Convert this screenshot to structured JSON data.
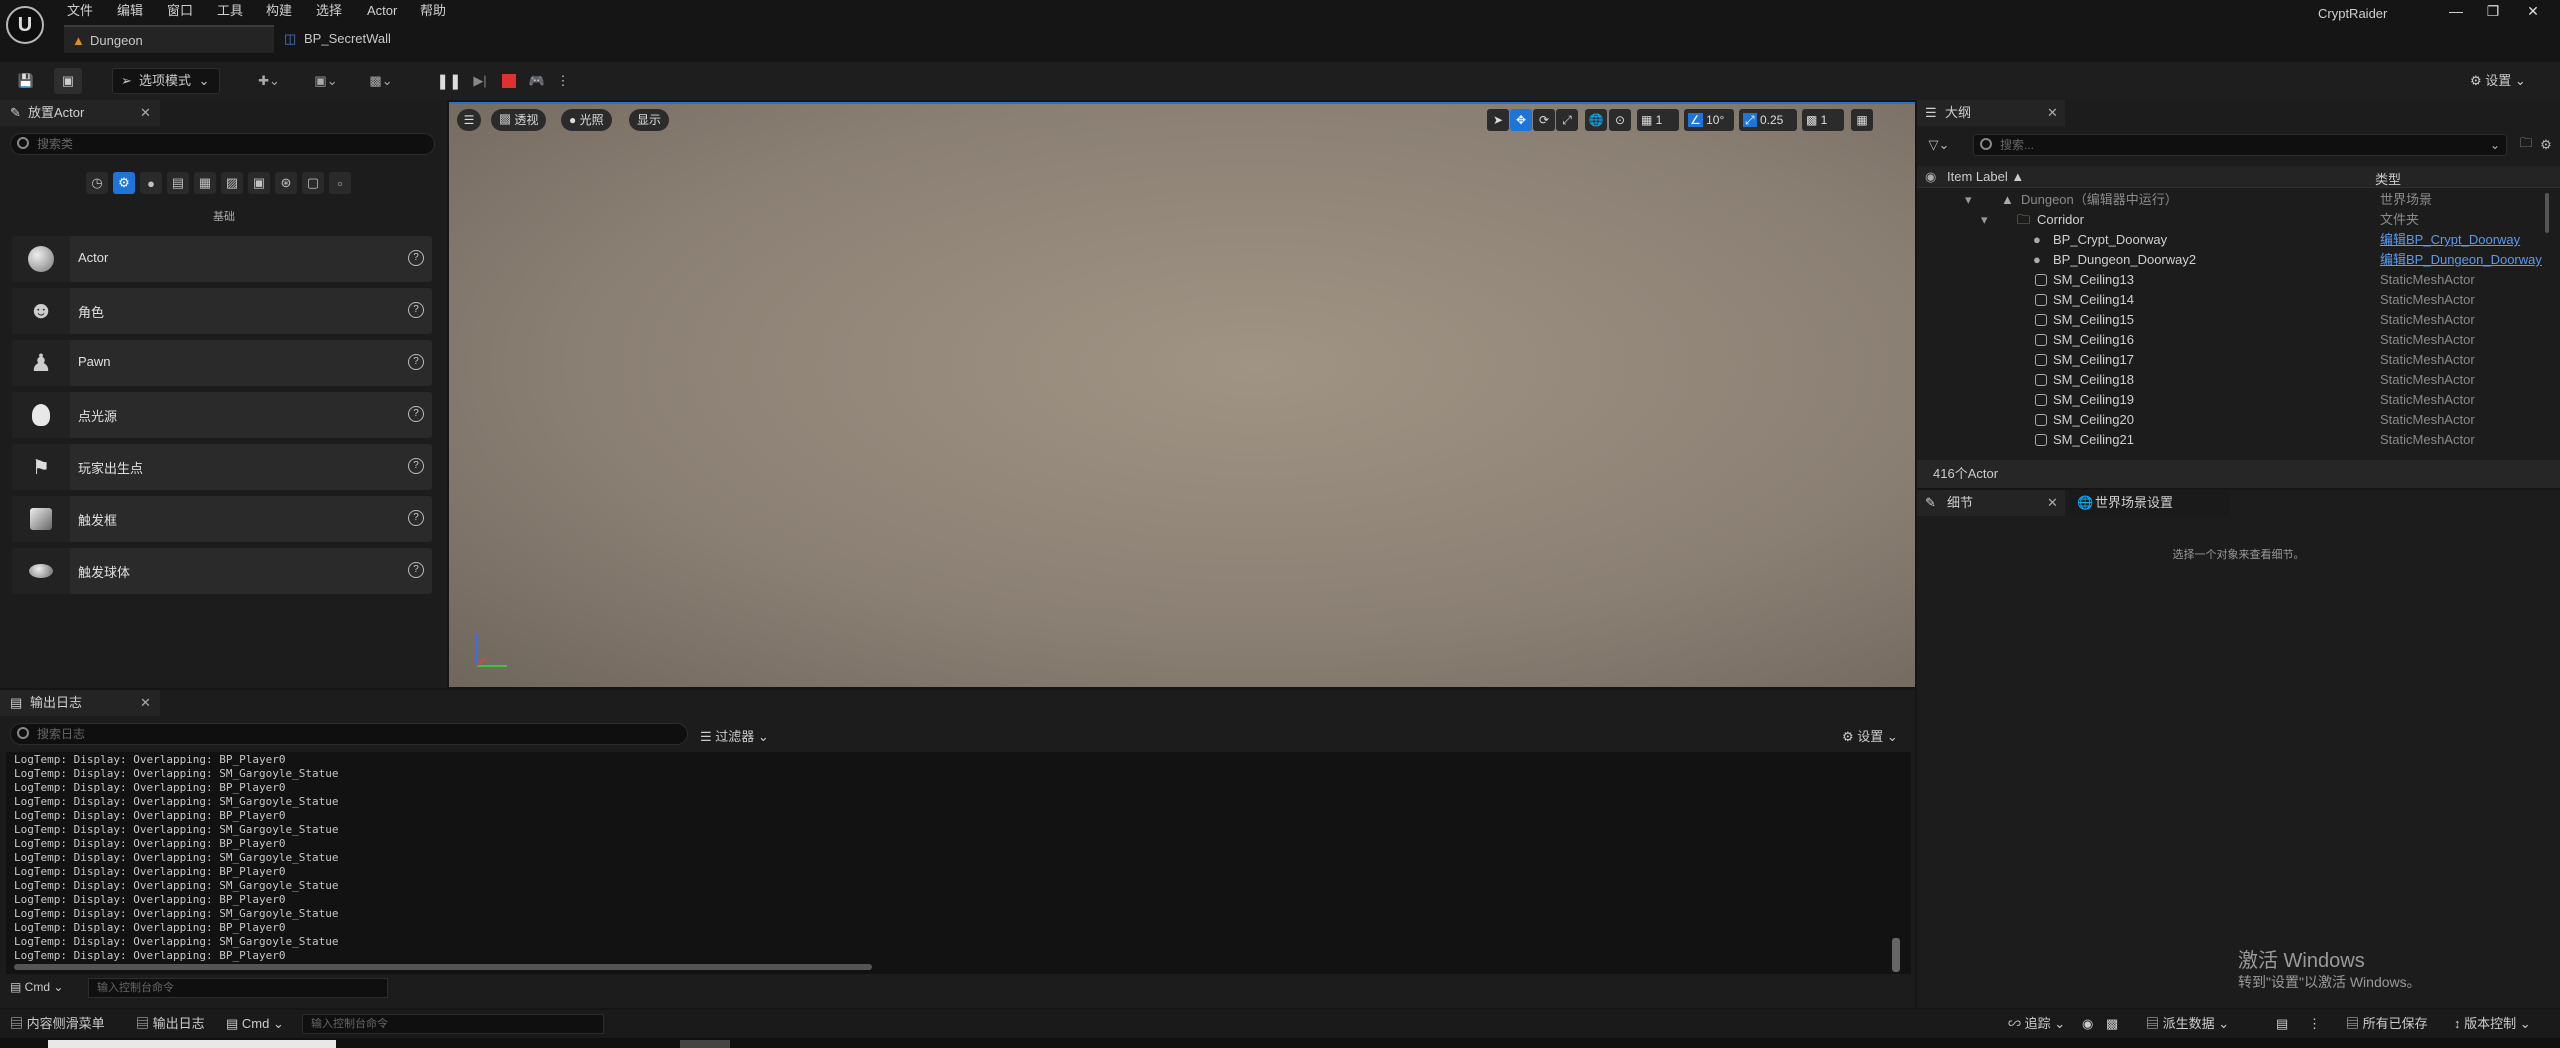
{
  "window": {
    "app_title": "CryptRaider",
    "menu": [
      "文件",
      "编辑",
      "窗口",
      "工具",
      "构建",
      "选择",
      "Actor",
      "帮助"
    ],
    "tabs": [
      {
        "label": "Dungeon"
      },
      {
        "label": "BP_SecretWall"
      }
    ]
  },
  "toolbar": {
    "mode_label": "选项模式",
    "settings_label": "设置"
  },
  "place_actors": {
    "title": "放置Actor",
    "search_placeholder": "搜索类",
    "category_label": "基础",
    "items": [
      {
        "label": "Actor",
        "icon": "sphere-icon"
      },
      {
        "label": "角色",
        "icon": "character-icon"
      },
      {
        "label": "Pawn",
        "icon": "pawn-icon"
      },
      {
        "label": "点光源",
        "icon": "lightbulb-icon"
      },
      {
        "label": "玩家出生点",
        "icon": "player-start-icon"
      },
      {
        "label": "触发框",
        "icon": "trigger-box-icon"
      },
      {
        "label": "触发球体",
        "icon": "trigger-sphere-icon"
      }
    ]
  },
  "viewport": {
    "perspective_label": "透视",
    "lighting_label": "光照",
    "show_label": "显示",
    "grid_value": "1",
    "angle_value": "10°",
    "scale_value": "0.25",
    "camera_speed": "1"
  },
  "outliner": {
    "title": "大纲",
    "search_placeholder": "搜索...",
    "col_label": "Item Label ▲",
    "col_type": "类型",
    "rows": [
      {
        "name": "Dungeon（编辑器中运行）",
        "type": "世界场景",
        "indent": 1,
        "kind": "world"
      },
      {
        "name": "Corridor",
        "type": "文件夹",
        "indent": 2,
        "kind": "folder"
      },
      {
        "name": "BP_Crypt_Doorway",
        "type": "编辑BP_Crypt_Doorway",
        "indent": 3,
        "kind": "bp"
      },
      {
        "name": "BP_Dungeon_Doorway2",
        "type": "编辑BP_Dungeon_Doorway",
        "indent": 3,
        "kind": "bp"
      },
      {
        "name": "SM_Ceiling13",
        "type": "StaticMeshActor",
        "indent": 3,
        "kind": "mesh"
      },
      {
        "name": "SM_Ceiling14",
        "type": "StaticMeshActor",
        "indent": 3,
        "kind": "mesh"
      },
      {
        "name": "SM_Ceiling15",
        "type": "StaticMeshActor",
        "indent": 3,
        "kind": "mesh"
      },
      {
        "name": "SM_Ceiling16",
        "type": "StaticMeshActor",
        "indent": 3,
        "kind": "mesh"
      },
      {
        "name": "SM_Ceiling17",
        "type": "StaticMeshActor",
        "indent": 3,
        "kind": "mesh"
      },
      {
        "name": "SM_Ceiling18",
        "type": "StaticMeshActor",
        "indent": 3,
        "kind": "mesh"
      },
      {
        "name": "SM_Ceiling19",
        "type": "StaticMeshActor",
        "indent": 3,
        "kind": "mesh"
      },
      {
        "name": "SM_Ceiling20",
        "type": "StaticMeshActor",
        "indent": 3,
        "kind": "mesh"
      },
      {
        "name": "SM_Ceiling21",
        "type": "StaticMeshActor",
        "indent": 3,
        "kind": "mesh"
      }
    ],
    "actor_count": "416个Actor"
  },
  "details": {
    "tab_details": "细节",
    "tab_world": "世界场景设置",
    "empty_hint": "选择一个对象来查看细节。"
  },
  "output_log": {
    "title": "输出日志",
    "search_placeholder": "搜索日志",
    "filter_label": "过滤器",
    "settings_label": "设置",
    "lines": [
      "LogTemp: Display: Overlapping: BP_Player0",
      "LogTemp: Display: Overlapping: SM_Gargoyle_Statue",
      "LogTemp: Display: Overlapping: BP_Player0",
      "LogTemp: Display: Overlapping: SM_Gargoyle_Statue",
      "LogTemp: Display: Overlapping: BP_Player0",
      "LogTemp: Display: Overlapping: SM_Gargoyle_Statue",
      "LogTemp: Display: Overlapping: BP_Player0",
      "LogTemp: Display: Overlapping: SM_Gargoyle_Statue",
      "LogTemp: Display: Overlapping: BP_Player0",
      "LogTemp: Display: Overlapping: SM_Gargoyle_Statue",
      "LogTemp: Display: Overlapping: BP_Player0",
      "LogTemp: Display: Overlapping: SM_Gargoyle_Statue",
      "LogTemp: Display: Overlapping: BP_Player0",
      "LogTemp: Display: Overlapping: SM_Gargoyle_Statue",
      "LogTemp: Display: Overlapping: BP_Player0"
    ],
    "cmd_label": "Cmd",
    "cmd_placeholder": "输入控制台命令"
  },
  "statusbar": {
    "content_drawer": "内容侧滑菜单",
    "output_log": "输出日志",
    "cmd_label": "Cmd",
    "cmd_placeholder": "输入控制台命令",
    "trace": "追踪",
    "derived_data": "派生数据",
    "all_saved": "所有已保存",
    "source_control": "版本控制"
  },
  "watermark": {
    "line1": "激活 Windows",
    "line2": "转到\"设置\"以激活 Windows。"
  },
  "colors": {
    "accent": "#1f74d8",
    "play_stop": "#e03030",
    "link": "#5a9bf0"
  }
}
